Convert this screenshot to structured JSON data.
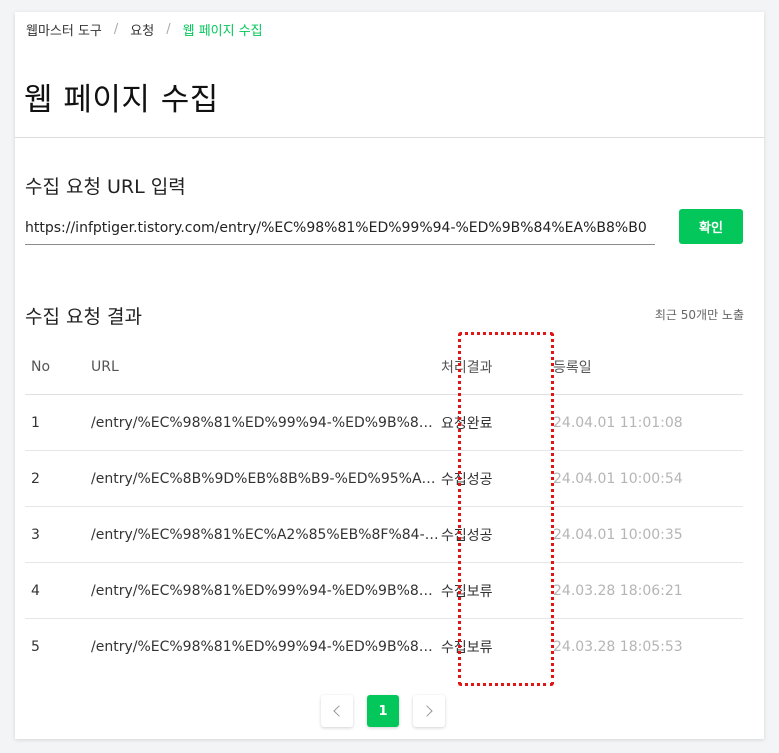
{
  "breadcrumb": {
    "items": [
      "웹마스터 도구",
      "요청",
      "웹 페이지 수집"
    ],
    "separator": "/"
  },
  "page": {
    "title": "웹 페이지 수집"
  },
  "request": {
    "section_title": "수집 요청 URL 입력",
    "url_value": "https://infptiger.tistory.com/entry/%EC%98%81%ED%99%94-%ED%9B%84%EA%B8%B0",
    "confirm_label": "확인"
  },
  "results": {
    "section_title": "수집 요청 결과",
    "note": "최근 50개만 노출",
    "columns": {
      "no": "No",
      "url": "URL",
      "status": "처리결과",
      "date": "등록일"
    },
    "rows": [
      {
        "no": "1",
        "url": "/entry/%EC%98%81%ED%99%94-%ED%9B%84…",
        "status": "요청완료",
        "date": "24.04.01 11:01:08"
      },
      {
        "no": "2",
        "url": "/entry/%EC%8B%9D%EB%8B%B9-%ED%95%A9…",
        "status": "수집성공",
        "date": "24.04.01 10:00:54"
      },
      {
        "no": "3",
        "url": "/entry/%EC%98%81%EC%A2%85%EB%8F%84-…",
        "status": "수집성공",
        "date": "24.04.01 10:00:35"
      },
      {
        "no": "4",
        "url": "/entry/%EC%98%81%ED%99%94-%ED%9B%84…",
        "status": "수집보류",
        "date": "24.03.28 18:06:21"
      },
      {
        "no": "5",
        "url": "/entry/%EC%98%81%ED%99%94-%ED%9B%84…",
        "status": "수집보류",
        "date": "24.03.28 18:05:53"
      }
    ]
  },
  "pagination": {
    "current": "1",
    "prev_icon": "chevron-left-icon",
    "next_icon": "chevron-right-icon"
  },
  "colors": {
    "accent": "#03c75a",
    "highlight": "#e01515"
  }
}
